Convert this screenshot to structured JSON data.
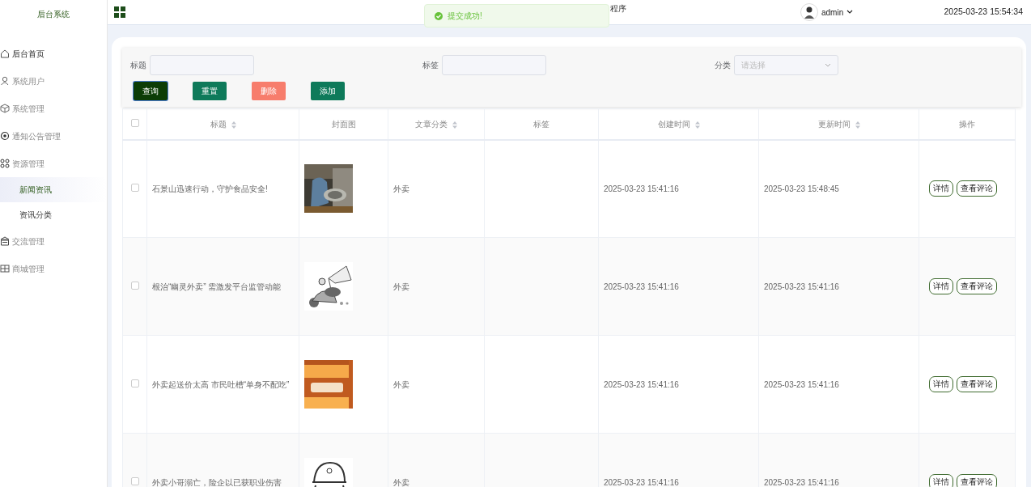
{
  "sidebar": {
    "title": "后台系统",
    "items": [
      {
        "label": "后台首页",
        "emphasized": true
      },
      {
        "label": "系统用户",
        "emphasized": false
      },
      {
        "label": "系统管理",
        "emphasized": false
      },
      {
        "label": "通知公告管理",
        "emphasized": false
      },
      {
        "label": "资源管理",
        "emphasized": false,
        "expanded": true,
        "children": [
          {
            "label": "新闻资讯",
            "selected": true
          },
          {
            "label": "资讯分类",
            "selected": false
          }
        ]
      },
      {
        "label": "交流管理",
        "emphasized": false
      },
      {
        "label": "商城管理",
        "emphasized": false
      }
    ]
  },
  "header": {
    "title": "程序",
    "user": "admin",
    "datetime": "2025-03-23 15:54:34"
  },
  "toast": {
    "message": "提交成功!"
  },
  "filters": [
    {
      "label": "标题",
      "kind": "input"
    },
    {
      "label": "标签",
      "kind": "input"
    },
    {
      "label": "分类",
      "kind": "select",
      "placeholder": "请选择"
    }
  ],
  "buttons": [
    {
      "label": "查询",
      "kind": "dark"
    },
    {
      "label": "重置",
      "kind": "green"
    },
    {
      "label": "删除",
      "kind": "danger"
    },
    {
      "label": "添加",
      "kind": "green"
    }
  ],
  "table": {
    "select_all": {
      "checked": false
    },
    "columns": [
      {
        "label": "标题",
        "kind": "sortable"
      },
      {
        "label": "封面图",
        "kind": "plain"
      },
      {
        "label": "文章分类",
        "kind": "sortable"
      },
      {
        "label": "标签",
        "kind": "plain"
      },
      {
        "label": "创建时间",
        "kind": "sortable"
      },
      {
        "label": "更新时间",
        "kind": "sortable"
      },
      {
        "label": "操作",
        "kind": "plain"
      }
    ],
    "rows": [
      {
        "checked": false,
        "title": "石景山迅速行动，守护食品安全!",
        "cover": {
          "kind": "picture"
        },
        "category": "外卖",
        "created": "2025-03-23 15:41:16",
        "updated": "2025-03-23 15:48:45",
        "actions": [
          "详情",
          "查看评论"
        ]
      },
      {
        "checked": false,
        "title": "根治“幽灵外卖” 需激发平台监管动能",
        "cover": {
          "kind": "picture"
        },
        "category": "外卖",
        "created": "2025-03-23 15:41:16",
        "updated": "2025-03-23 15:41:16",
        "actions": [
          "详情",
          "查看评论"
        ]
      },
      {
        "checked": false,
        "title": "外卖起送价太高 市民吐槽“单身不配吃”",
        "cover": {
          "kind": "picture"
        },
        "category": "外卖",
        "created": "2025-03-23 15:41:16",
        "updated": "2025-03-23 15:41:16",
        "actions": [
          "详情",
          "查看评论"
        ]
      },
      {
        "checked": false,
        "title": "外卖小哥溺亡，险企以已获职业伤害",
        "cover": {
          "kind": "picture"
        },
        "category": "外卖",
        "created": "2025-03-23 15:41:16",
        "updated": "2025-03-23 15:41:16",
        "actions": [
          "详情",
          "查看评论"
        ]
      }
    ]
  }
}
